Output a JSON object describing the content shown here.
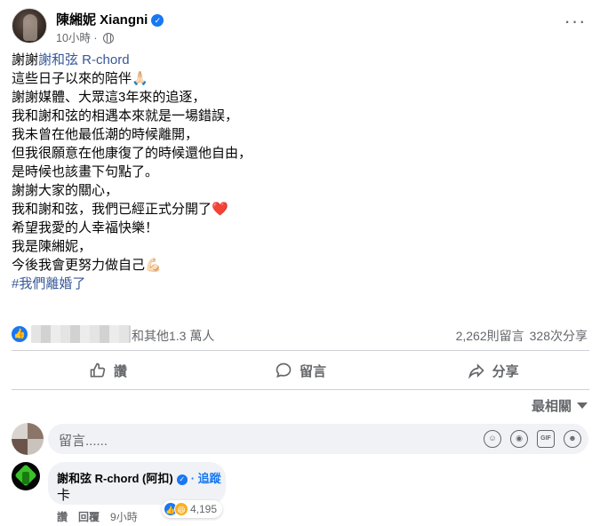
{
  "post": {
    "author": "陳緗妮 Xiangni",
    "time": "10小時",
    "more": "···",
    "lines": {
      "l1_prefix": "謝謝",
      "l1_link": "謝和弦 R-chord",
      "l2": "這些日子以來的陪伴🙏🏻",
      "l3": "謝謝媒體、大眾這3年來的追逐，",
      "l4": "我和謝和弦的相遇本來就是一場錯誤，",
      "l5": "我未曾在他最低潮的時候離開，",
      "l6": "但我很願意在他康復了的時候還他自由，",
      "l7": "是時候也該畫下句點了。",
      "l8": "謝謝大家的關心，",
      "l9": "我和謝和弦，我們已經正式分開了❤️",
      "l10": "希望我愛的人幸福快樂！",
      "l11": "我是陳緗妮，",
      "l12": "今後我會更努力做自己💪🏻",
      "hashtag": "#我們離婚了"
    }
  },
  "stats": {
    "reactions_text": "和其他1.3 萬人",
    "comments": "2,262則留言",
    "shares": "328次分享"
  },
  "actions": {
    "like": "讚",
    "comment": "留言",
    "share": "分享"
  },
  "comments": {
    "sort_label": "最相關",
    "composer_placeholder": "留言......",
    "items": [
      {
        "name": "謝和弦 R-chord (阿扣)",
        "follow": "· 追蹤",
        "text": "卡",
        "reaction_count": "4,195",
        "like": "讚",
        "reply": "回覆",
        "time": "9小時"
      }
    ]
  },
  "colors": {
    "accent": "#1877f2",
    "link": "#385898",
    "secondary_text": "#65676b",
    "bubble": "#f0f2f5"
  }
}
